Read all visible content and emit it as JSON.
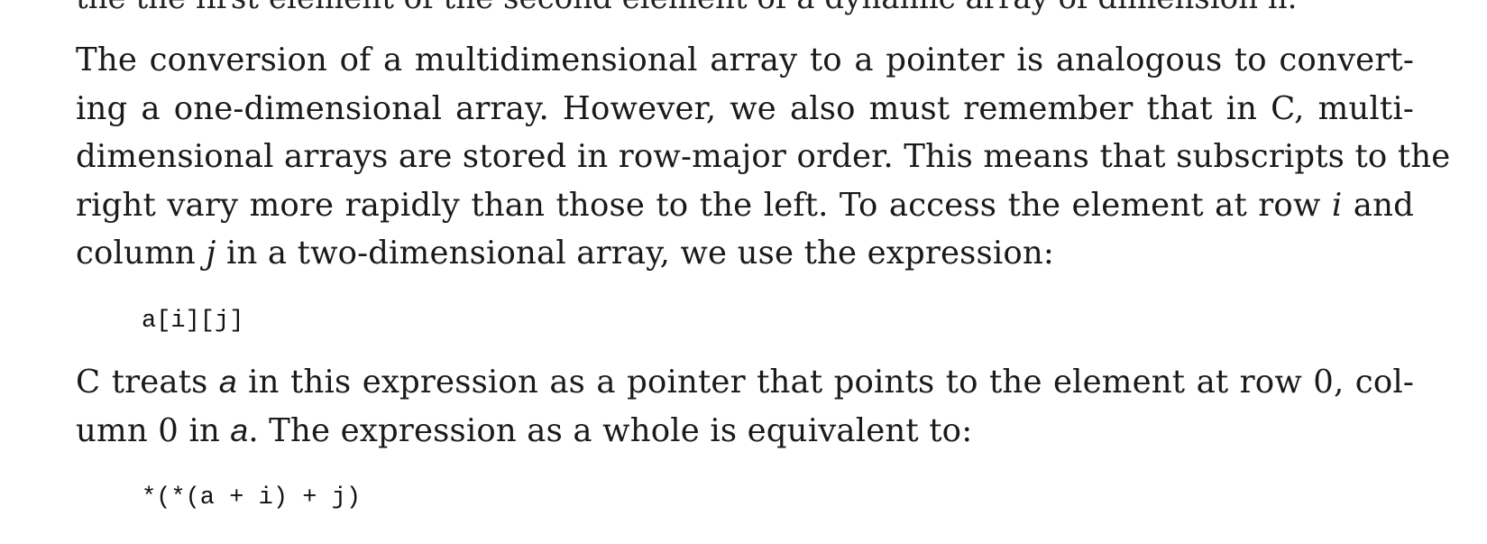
{
  "previous_line": "the the first element of the second element of a dynamic array of dimension n.",
  "paragraph1": {
    "line1": "The conversion of a multidimensional array to a pointer is analogous to convert-",
    "line2": "ing a one-dimensional array. However, we also must remember that in C, multi-",
    "line3": "dimensional arrays are stored in row-major order. This means that subscripts to the",
    "line4_before_i": "right vary more rapidly than those to the left. To access the element at row ",
    "var_i": "i",
    "line4_after_i": " and",
    "line5_before_j": "column ",
    "var_j": "j",
    "line5_after_j": " in a two-dimensional array, we use the expression:"
  },
  "code1": "a[i][j]",
  "paragraph2": {
    "line1_before_a": "C treats ",
    "var_a": "a",
    "line1_after_a": " in this expression as a pointer that points to the element at row 0, col-",
    "line2_before_a": "umn 0 in ",
    "line2_var_a": "a",
    "line2_after_a": ". The expression as a whole is equivalent to:"
  },
  "code2": "*(*(a + i) + j)"
}
